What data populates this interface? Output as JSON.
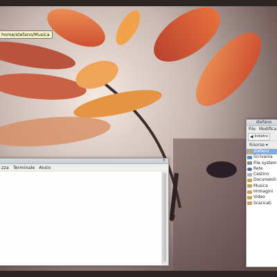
{
  "tooltip": {
    "text": "home/stefano/Musica"
  },
  "terminal": {
    "menu": [
      "zza",
      "Terminale",
      "Aiuto"
    ]
  },
  "file_manager": {
    "title": "stefano",
    "menu": [
      "File",
      "Modifica"
    ],
    "toolbar_button": "Indietro",
    "places_header": "Risorse",
    "places": [
      {
        "label": "stefano",
        "icon": "home-folder-icon",
        "selected": true
      },
      {
        "label": "Scrivania",
        "icon": "desktop-icon",
        "selected": false
      },
      {
        "label": "File system",
        "icon": "filesystem-icon",
        "selected": false
      },
      {
        "label": "Rete",
        "icon": "network-icon",
        "selected": false
      },
      {
        "label": "Cestino",
        "icon": "trash-icon",
        "selected": false
      },
      {
        "label": "Documenti",
        "icon": "folder-icon",
        "selected": false
      },
      {
        "label": "Musica",
        "icon": "folder-icon",
        "selected": false
      },
      {
        "label": "Immagini",
        "icon": "folder-icon",
        "selected": false
      },
      {
        "label": "Video",
        "icon": "folder-icon",
        "selected": false
      },
      {
        "label": "Scaricati",
        "icon": "folder-icon",
        "selected": false
      }
    ]
  },
  "colors": {
    "selection": "#86abd9",
    "panel": "#2b2624"
  }
}
